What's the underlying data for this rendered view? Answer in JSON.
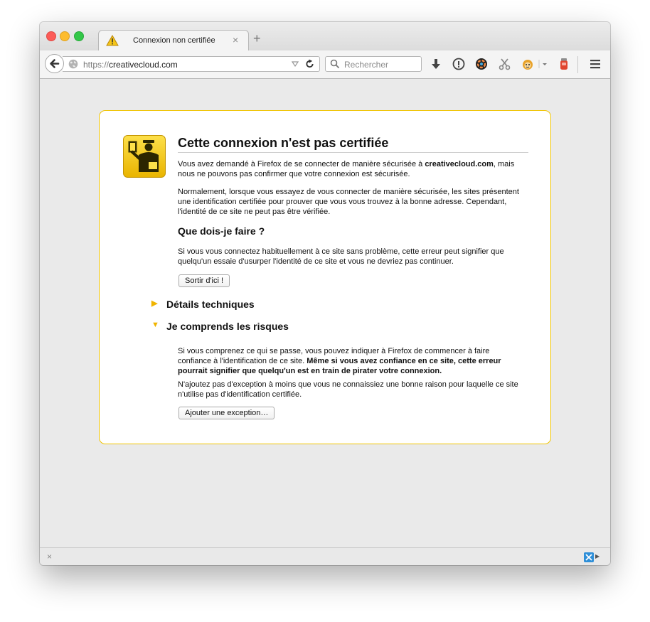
{
  "tab": {
    "title": "Connexion non certifiée"
  },
  "navbar": {
    "url_protocol": "https://",
    "url_host": "creativecloud.com",
    "search_placeholder": "Rechercher"
  },
  "error": {
    "title": "Cette connexion n'est pas certifiée",
    "p1_before": "Vous avez demandé à Firefox de se connecter de manière sécurisée à ",
    "p1_host": "creativecloud.com",
    "p1_after": ", mais nous ne pouvons pas confirmer que votre connexion est sécurisée.",
    "p2": "Normalement, lorsque vous essayez de vous connecter de manière sécurisée, les sites présentent une identification certifiée pour prouver que vous vous trouvez à la bonne adresse. Cependant, l'identité de ce site ne peut pas être vérifiée.",
    "what_heading": "Que dois-je faire ?",
    "what_text": "Si vous vous connectez habituellement à ce site sans problème, cette erreur peut signifier que quelqu'un essaie d'usurper l'identité de ce site et vous ne devriez pas continuer.",
    "leave_button": "Sortir d'ici !",
    "technical_details": "Détails techniques",
    "risks_heading": "Je comprends les risques",
    "risks_text_plain": "Si vous comprenez ce qui se passe, vous pouvez indiquer à Firefox de commencer à faire confiance à l'identification de ce site. ",
    "risks_text_bold": "Même si vous avez confiance en ce site, cette erreur pourrait signifier que quelqu'un est en train de pirater votre connexion.",
    "exception_text": "N'ajoutez pas d'exception à moins que vous ne connaissiez une bonne raison pour laquelle ce site n'utilise pas d'identification certifiée.",
    "exception_button": "Ajouter une exception…"
  },
  "colors": {
    "accent": "#f0c400",
    "badge": "#f5c61a"
  }
}
